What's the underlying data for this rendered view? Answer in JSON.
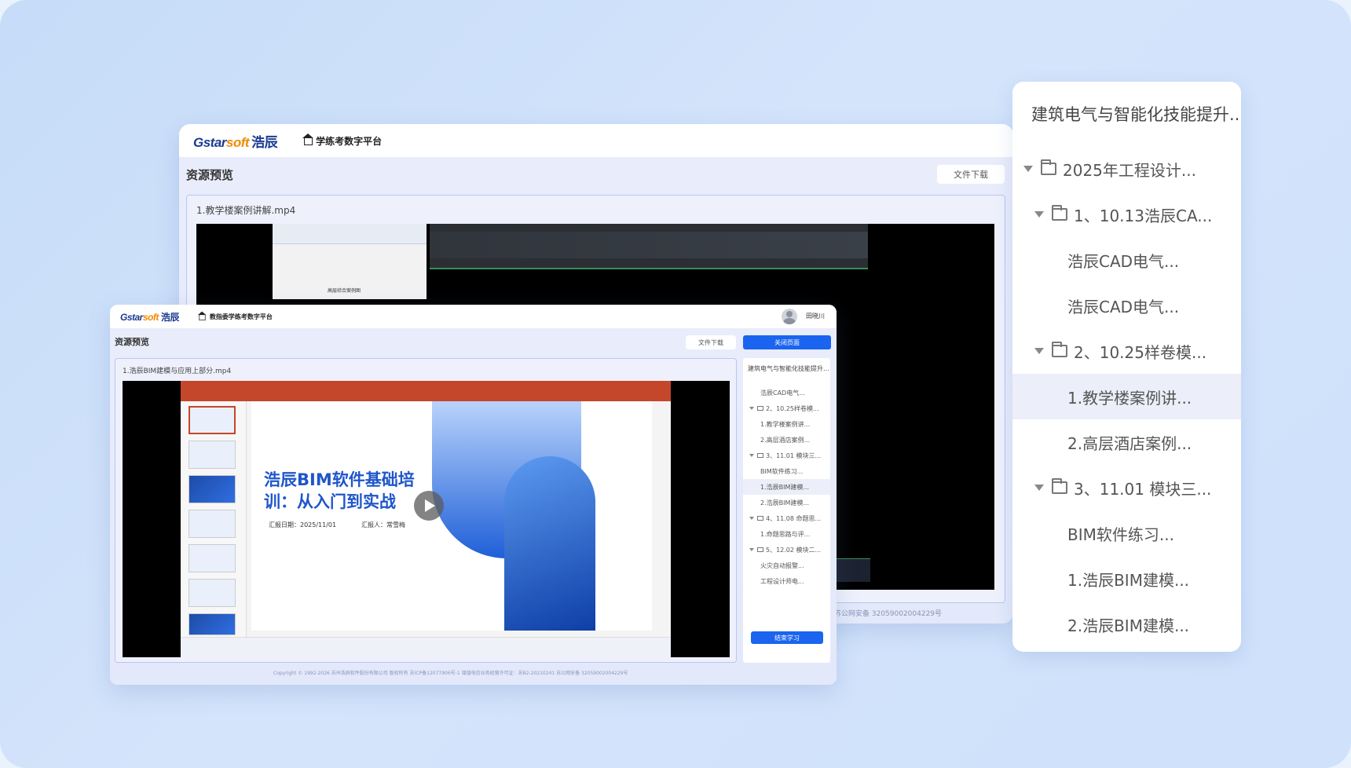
{
  "back_window": {
    "logo": {
      "brand": "Gstar",
      "brand_accent": "soft",
      "brand_cn": "浩辰"
    },
    "platform_title": "学练考数字平台",
    "page_title": "资源预览",
    "download_label": "文件下载",
    "file_name": "1.教学楼案例讲解.mp4",
    "footer_fragment": "苏公网安备 32059002004229号",
    "video_caption": "高层综合案例图"
  },
  "front_window": {
    "logo": {
      "brand": "Gstar",
      "brand_accent": "soft",
      "brand_cn": "浩辰"
    },
    "platform_title": "教指委学练考数字平台",
    "user_name": "田晓川",
    "page_title": "资源预览",
    "download_label": "文件下载",
    "close_label": "关闭页面",
    "file_name": "1.浩辰BIM建模与应用上部分.mp4",
    "slide": {
      "title_line1": "浩辰BIM软件基础培",
      "title_line2": "训：从入门到实战",
      "report_date": "汇报日期：2025/11/01",
      "reporter": "汇报人：常雪梅"
    },
    "sidebar": {
      "title": "建筑电气与智能化技能提升...",
      "items": [
        {
          "label": "浩辰CAD电气...",
          "type": "file"
        },
        {
          "label": "2、10.25样卷模...",
          "type": "folder"
        },
        {
          "label": "1.教学楼案例讲...",
          "type": "file"
        },
        {
          "label": "2.高层酒店案例...",
          "type": "file"
        },
        {
          "label": "3、11.01 模块三...",
          "type": "folder"
        },
        {
          "label": "BIM软件练习...",
          "type": "file"
        },
        {
          "label": "1.浩辰BIM建模...",
          "type": "file",
          "selected": true
        },
        {
          "label": "2.浩辰BIM建模...",
          "type": "file"
        },
        {
          "label": "4、11.08 命题思...",
          "type": "folder"
        },
        {
          "label": "1.命题思路与评...",
          "type": "file"
        },
        {
          "label": "5、12.02 模块二...",
          "type": "folder"
        },
        {
          "label": "火灾自动报警...",
          "type": "file"
        },
        {
          "label": "工程设计师电...",
          "type": "file"
        }
      ],
      "finish_label": "结束学习"
    },
    "footer": "Copyright © 1992-2026 苏州浩辰软件股份有限公司 版权所有 苏ICP备12077906号-1 增值电信业务经营许可证：苏B2-20210241  苏公网安备 32059002004229号"
  },
  "tree_panel": {
    "title": "建筑电气与智能化技能提升...",
    "items": [
      {
        "label": "2025年工程设计...",
        "type": "folder",
        "level": 0
      },
      {
        "label": "1、10.13浩辰CA...",
        "type": "folder",
        "level": 1
      },
      {
        "label": "浩辰CAD电气...",
        "type": "file",
        "level": 2
      },
      {
        "label": "浩辰CAD电气...",
        "type": "file",
        "level": 2
      },
      {
        "label": "2、10.25样卷模...",
        "type": "folder",
        "level": 1
      },
      {
        "label": "1.教学楼案例讲...",
        "type": "file",
        "level": 2,
        "selected": true
      },
      {
        "label": "2.高层酒店案例...",
        "type": "file",
        "level": 2
      },
      {
        "label": "3、11.01 模块三...",
        "type": "folder",
        "level": 1
      },
      {
        "label": "BIM软件练习...",
        "type": "file",
        "level": 2
      },
      {
        "label": "1.浩辰BIM建模...",
        "type": "file",
        "level": 2
      },
      {
        "label": "2.浩辰BIM建模...",
        "type": "file",
        "level": 2
      }
    ]
  },
  "colors": {
    "accent": "#1a64f0",
    "brand_blue": "#1a3b8f",
    "brand_orange": "#f08c00",
    "ppt_red": "#c4472b"
  }
}
